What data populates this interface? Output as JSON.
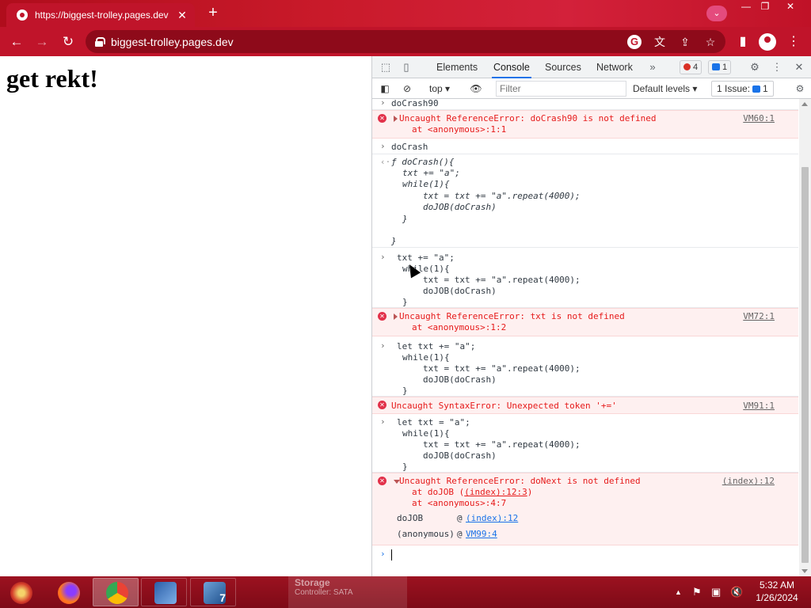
{
  "browser": {
    "tab_title": "https://biggest-trolley.pages.dev",
    "url": "biggest-trolley.pages.dev"
  },
  "page": {
    "heading": "get rekt!"
  },
  "devtools": {
    "tabs": [
      "Elements",
      "Console",
      "Sources",
      "Network"
    ],
    "active_tab": "Console",
    "error_count": "4",
    "message_count": "1",
    "context": "top",
    "filter_placeholder": "Filter",
    "levels": "Default levels",
    "issues_label": "1 Issue:",
    "issues_count": "1"
  },
  "console": {
    "e1_input": "doCrash90",
    "e2_error": "Uncaught ReferenceError: doCrash90 is not defined",
    "e2_at": "at <anonymous>:1:1",
    "e2_src": "VM60:1",
    "e3_input": "doCrash",
    "e4_l1": "ƒ doCrash(){",
    "e4_l2": "txt += \"a\";",
    "e4_l3": "while(1){",
    "e4_l4": "txt = txt += \"a\".repeat(4000);",
    "e4_l5": "doJOB(doCrash)",
    "e4_l6": "}",
    "e4_l7": "}",
    "e5_l1": "txt += \"a\";",
    "e5_l2": "while(1){",
    "e5_l3": "txt = txt += \"a\".repeat(4000);",
    "e5_l4": "doJOB(doCrash)",
    "e5_l5": "}",
    "e6_error": "Uncaught ReferenceError: txt is not defined",
    "e6_at": "at <anonymous>:1:2",
    "e6_src": "VM72:1",
    "e7_l1": "let txt += \"a\";",
    "e7_l2": "while(1){",
    "e7_l3": "txt = txt += \"a\".repeat(4000);",
    "e7_l4": "doJOB(doCrash)",
    "e7_l5": "}",
    "e8_error": "Uncaught SyntaxError: Unexpected token '+='",
    "e8_src": "VM91:1",
    "e9_l1": "let txt = \"a\";",
    "e9_l2": "while(1){",
    "e9_l3": "txt = txt += \"a\".repeat(4000);",
    "e9_l4": "doJOB(doCrash)",
    "e9_l5": "}",
    "e10_error": "Uncaught ReferenceError: doNext is not defined",
    "e10_src": "(index):12",
    "e10_at1_pre": "at doJOB (",
    "e10_at1_link": "(index):12:3",
    "e10_at1_post": ")",
    "e10_at2": "at <anonymous>:4:7",
    "e10_stack1_fn": "doJOB",
    "e10_stack1_at": "@",
    "e10_stack1_link": "(index):12",
    "e10_stack2_fn": "(anonymous)",
    "e10_stack2_at": "@",
    "e10_stack2_link": "VM99:4"
  },
  "taskbar": {
    "ghost_title": "Storage",
    "ghost_sub": "Controller: SATA",
    "time": "5:32 AM",
    "date": "1/26/2024"
  },
  "colors": {
    "chrome_frame": "#c0142a",
    "error_text": "#e61a1a",
    "error_bg": "#fef0f0",
    "accent_blue": "#1a73e8"
  }
}
